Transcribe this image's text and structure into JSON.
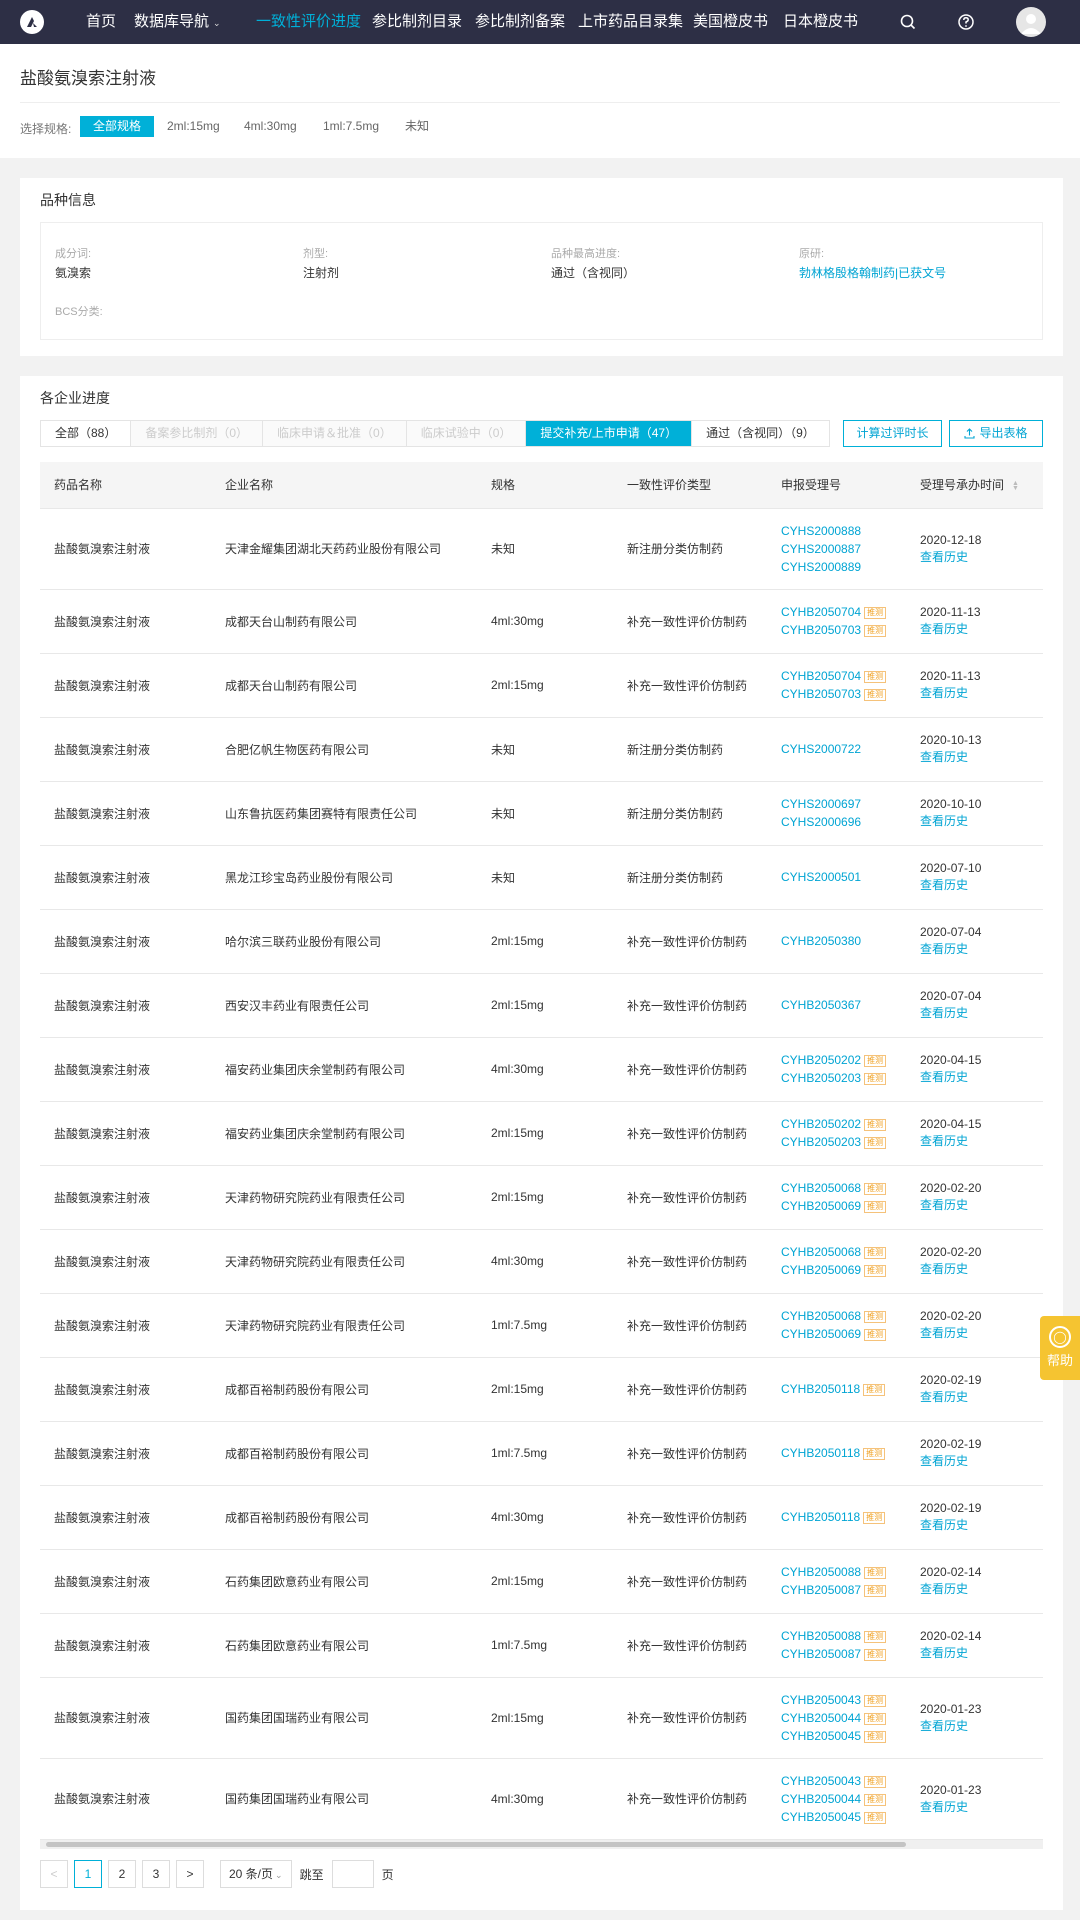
{
  "nav": {
    "items": [
      {
        "label": "首页",
        "active": false
      },
      {
        "label": "数据库导航",
        "active": false,
        "dropdown": true
      },
      {
        "label": "一致性评价进度",
        "active": true
      },
      {
        "label": "参比制剂目录",
        "active": false
      },
      {
        "label": "参比制剂备案",
        "active": false
      },
      {
        "label": "上市药品目录集",
        "active": false
      },
      {
        "label": "美国橙皮书",
        "active": false
      },
      {
        "label": "日本橙皮书",
        "active": false
      }
    ],
    "icons": [
      "search-icon",
      "help-circle-icon",
      "user-avatar"
    ]
  },
  "page": {
    "title": "盐酸氨溴索注射液",
    "spec_label": "选择规格:",
    "specs": [
      {
        "label": "全部规格",
        "active": true
      },
      {
        "label": "2ml:15mg",
        "active": false
      },
      {
        "label": "4ml:30mg",
        "active": false
      },
      {
        "label": "1ml:7.5mg",
        "active": false
      },
      {
        "label": "未知",
        "active": false
      }
    ]
  },
  "info": {
    "title": "品种信息",
    "ingredient_label": "成分词:",
    "ingredient": "氨溴索",
    "form_label": "剂型:",
    "form": "注射剂",
    "progress_label": "品种最高进度:",
    "progress": "通过（含视同）",
    "original_label": "原研:",
    "original": "勃林格殷格翰制药|已获文号",
    "bcs_label": "BCS分类:",
    "bcs": ""
  },
  "progress": {
    "title": "各企业进度",
    "tabs": [
      {
        "label": "全部（88）",
        "state": "normal"
      },
      {
        "label": "备案参比制剂（0）",
        "state": "disabled"
      },
      {
        "label": "临床申请＆批准（0）",
        "state": "disabled"
      },
      {
        "label": "临床试验中（0）",
        "state": "disabled"
      },
      {
        "label": "提交补充/上市申请（47）",
        "state": "active"
      },
      {
        "label": "通过（含视同）（9）",
        "state": "normal"
      }
    ],
    "calc_button": "计算过评时长",
    "export_button": "导出表格",
    "columns": [
      "药品名称",
      "企业名称",
      "规格",
      "一致性评价类型",
      "申报受理号",
      "受理号承办时间"
    ],
    "tag_label": "推测",
    "history_label": "查看历史",
    "rows": [
      {
        "drug": "盐酸氨溴索注射液",
        "company": "天津金耀集团湖北天药药业股份有限公司",
        "spec": "未知",
        "type": "新注册分类仿制药",
        "nos": [
          {
            "no": "CYHS2000888",
            "tag": false
          },
          {
            "no": "CYHS2000887",
            "tag": false
          },
          {
            "no": "CYHS2000889",
            "tag": false
          }
        ],
        "date": "2020-12-18"
      },
      {
        "drug": "盐酸氨溴索注射液",
        "company": "成都天台山制药有限公司",
        "spec": "4ml:30mg",
        "type": "补充一致性评价仿制药",
        "nos": [
          {
            "no": "CYHB2050704",
            "tag": true
          },
          {
            "no": "CYHB2050703",
            "tag": true
          }
        ],
        "date": "2020-11-13"
      },
      {
        "drug": "盐酸氨溴索注射液",
        "company": "成都天台山制药有限公司",
        "spec": "2ml:15mg",
        "type": "补充一致性评价仿制药",
        "nos": [
          {
            "no": "CYHB2050704",
            "tag": true
          },
          {
            "no": "CYHB2050703",
            "tag": true
          }
        ],
        "date": "2020-11-13"
      },
      {
        "drug": "盐酸氨溴索注射液",
        "company": "合肥亿帆生物医药有限公司",
        "spec": "未知",
        "type": "新注册分类仿制药",
        "nos": [
          {
            "no": "CYHS2000722",
            "tag": false
          }
        ],
        "date": "2020-10-13"
      },
      {
        "drug": "盐酸氨溴索注射液",
        "company": "山东鲁抗医药集团赛特有限责任公司",
        "spec": "未知",
        "type": "新注册分类仿制药",
        "nos": [
          {
            "no": "CYHS2000697",
            "tag": false
          },
          {
            "no": "CYHS2000696",
            "tag": false
          }
        ],
        "date": "2020-10-10"
      },
      {
        "drug": "盐酸氨溴索注射液",
        "company": "黑龙江珍宝岛药业股份有限公司",
        "spec": "未知",
        "type": "新注册分类仿制药",
        "nos": [
          {
            "no": "CYHS2000501",
            "tag": false
          }
        ],
        "date": "2020-07-10"
      },
      {
        "drug": "盐酸氨溴索注射液",
        "company": "哈尔滨三联药业股份有限公司",
        "spec": "2ml:15mg",
        "type": "补充一致性评价仿制药",
        "nos": [
          {
            "no": "CYHB2050380",
            "tag": false
          }
        ],
        "date": "2020-07-04"
      },
      {
        "drug": "盐酸氨溴索注射液",
        "company": "西安汉丰药业有限责任公司",
        "spec": "2ml:15mg",
        "type": "补充一致性评价仿制药",
        "nos": [
          {
            "no": "CYHB2050367",
            "tag": false
          }
        ],
        "date": "2020-07-04"
      },
      {
        "drug": "盐酸氨溴索注射液",
        "company": "福安药业集团庆余堂制药有限公司",
        "spec": "4ml:30mg",
        "type": "补充一致性评价仿制药",
        "nos": [
          {
            "no": "CYHB2050202",
            "tag": true
          },
          {
            "no": "CYHB2050203",
            "tag": true
          }
        ],
        "date": "2020-04-15"
      },
      {
        "drug": "盐酸氨溴索注射液",
        "company": "福安药业集团庆余堂制药有限公司",
        "spec": "2ml:15mg",
        "type": "补充一致性评价仿制药",
        "nos": [
          {
            "no": "CYHB2050202",
            "tag": true
          },
          {
            "no": "CYHB2050203",
            "tag": true
          }
        ],
        "date": "2020-04-15"
      },
      {
        "drug": "盐酸氨溴索注射液",
        "company": "天津药物研究院药业有限责任公司",
        "spec": "2ml:15mg",
        "type": "补充一致性评价仿制药",
        "nos": [
          {
            "no": "CYHB2050068",
            "tag": true
          },
          {
            "no": "CYHB2050069",
            "tag": true
          }
        ],
        "date": "2020-02-20"
      },
      {
        "drug": "盐酸氨溴索注射液",
        "company": "天津药物研究院药业有限责任公司",
        "spec": "4ml:30mg",
        "type": "补充一致性评价仿制药",
        "nos": [
          {
            "no": "CYHB2050068",
            "tag": true
          },
          {
            "no": "CYHB2050069",
            "tag": true
          }
        ],
        "date": "2020-02-20"
      },
      {
        "drug": "盐酸氨溴索注射液",
        "company": "天津药物研究院药业有限责任公司",
        "spec": "1ml:7.5mg",
        "type": "补充一致性评价仿制药",
        "nos": [
          {
            "no": "CYHB2050068",
            "tag": true
          },
          {
            "no": "CYHB2050069",
            "tag": true
          }
        ],
        "date": "2020-02-20"
      },
      {
        "drug": "盐酸氨溴索注射液",
        "company": "成都百裕制药股份有限公司",
        "spec": "2ml:15mg",
        "type": "补充一致性评价仿制药",
        "nos": [
          {
            "no": "CYHB2050118",
            "tag": true
          }
        ],
        "date": "2020-02-19"
      },
      {
        "drug": "盐酸氨溴索注射液",
        "company": "成都百裕制药股份有限公司",
        "spec": "1ml:7.5mg",
        "type": "补充一致性评价仿制药",
        "nos": [
          {
            "no": "CYHB2050118",
            "tag": true
          }
        ],
        "date": "2020-02-19"
      },
      {
        "drug": "盐酸氨溴索注射液",
        "company": "成都百裕制药股份有限公司",
        "spec": "4ml:30mg",
        "type": "补充一致性评价仿制药",
        "nos": [
          {
            "no": "CYHB2050118",
            "tag": true
          }
        ],
        "date": "2020-02-19"
      },
      {
        "drug": "盐酸氨溴索注射液",
        "company": "石药集团欧意药业有限公司",
        "spec": "2ml:15mg",
        "type": "补充一致性评价仿制药",
        "nos": [
          {
            "no": "CYHB2050088",
            "tag": true
          },
          {
            "no": "CYHB2050087",
            "tag": true
          }
        ],
        "date": "2020-02-14"
      },
      {
        "drug": "盐酸氨溴索注射液",
        "company": "石药集团欧意药业有限公司",
        "spec": "1ml:7.5mg",
        "type": "补充一致性评价仿制药",
        "nos": [
          {
            "no": "CYHB2050088",
            "tag": true
          },
          {
            "no": "CYHB2050087",
            "tag": true
          }
        ],
        "date": "2020-02-14"
      },
      {
        "drug": "盐酸氨溴索注射液",
        "company": "国药集团国瑞药业有限公司",
        "spec": "2ml:15mg",
        "type": "补充一致性评价仿制药",
        "nos": [
          {
            "no": "CYHB2050043",
            "tag": true
          },
          {
            "no": "CYHB2050044",
            "tag": true
          },
          {
            "no": "CYHB2050045",
            "tag": true
          }
        ],
        "date": "2020-01-23"
      },
      {
        "drug": "盐酸氨溴索注射液",
        "company": "国药集团国瑞药业有限公司",
        "spec": "4ml:30mg",
        "type": "补充一致性评价仿制药",
        "nos": [
          {
            "no": "CYHB2050043",
            "tag": true
          },
          {
            "no": "CYHB2050044",
            "tag": true
          },
          {
            "no": "CYHB2050045",
            "tag": true
          }
        ],
        "date": "2020-01-23"
      }
    ]
  },
  "pagination": {
    "prev": "<",
    "next": ">",
    "pages": [
      "1",
      "2",
      "3"
    ],
    "current": "1",
    "page_size": "20 条/页",
    "jump_label": "跳至",
    "page_unit": "页"
  },
  "help_widget": {
    "label": "帮助"
  },
  "colors": {
    "accent": "#00b0d8",
    "nav_bg": "#2d2f45",
    "tag": "#f0a020",
    "help": "#f5c431"
  }
}
